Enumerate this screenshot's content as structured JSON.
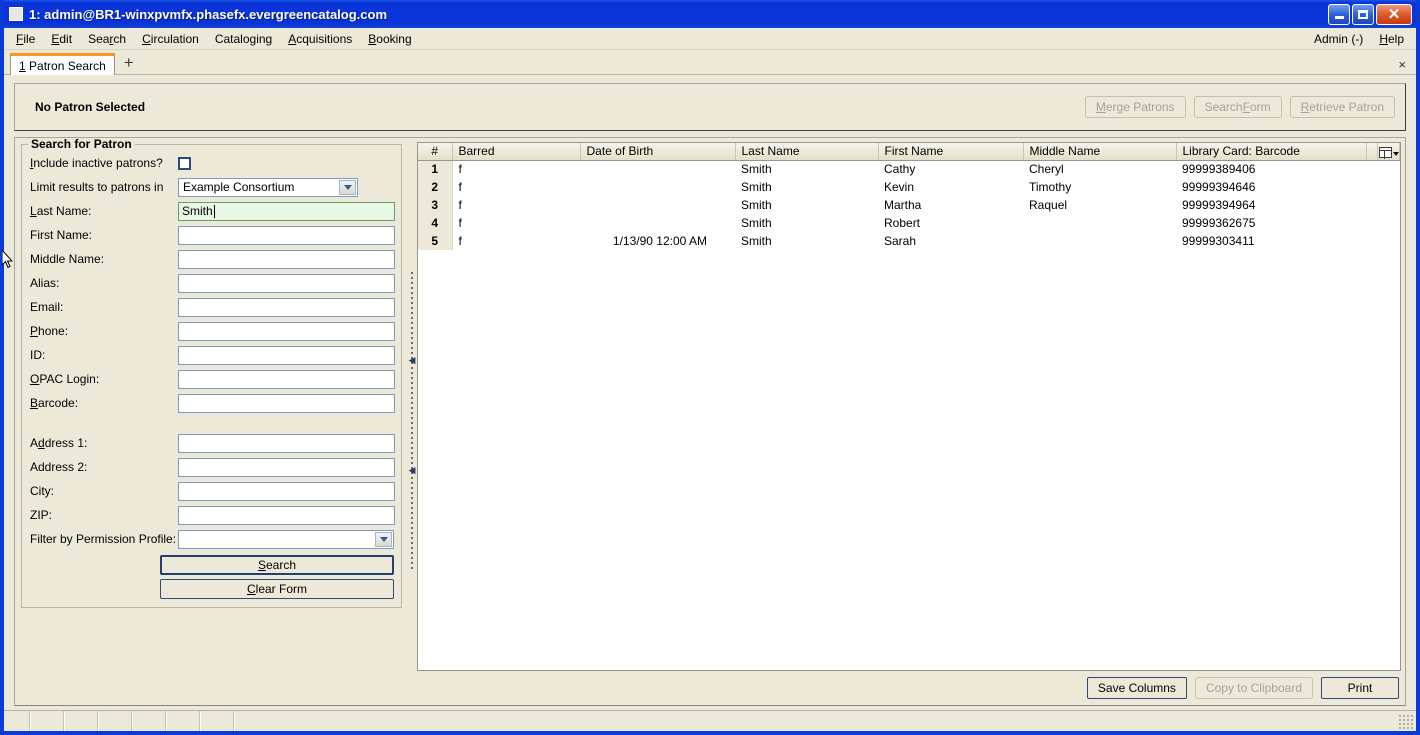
{
  "window": {
    "title": "1: admin@BR1-winxpvmfx.phasefx.evergreencatalog.com",
    "app_icon": "app-icon",
    "minimize_label": "Minimize",
    "maximize_label": "Maximize",
    "close_label": "Close"
  },
  "menubar": {
    "items": [
      {
        "label": "File",
        "accel": "F"
      },
      {
        "label": "Edit",
        "accel": "E"
      },
      {
        "label": "Search",
        "accel": "r"
      },
      {
        "label": "Circulation",
        "accel": "C"
      },
      {
        "label": "Cataloging",
        "accel": "g"
      },
      {
        "label": "Acquisitions",
        "accel": "A"
      },
      {
        "label": "Booking",
        "accel": "B"
      }
    ],
    "right_items": [
      {
        "label": "Admin (-)"
      },
      {
        "label": "Help"
      }
    ]
  },
  "tabs": {
    "items": [
      {
        "index": "1",
        "label": "Patron Search"
      }
    ],
    "add_label": "+",
    "close_label": "×"
  },
  "patron_header": {
    "status": "No Patron Selected",
    "buttons": [
      {
        "label": "Merge Patrons",
        "disabled": true
      },
      {
        "label": "Search Form",
        "disabled": true
      },
      {
        "label": "Retrieve Patron",
        "disabled": true
      }
    ]
  },
  "search_form": {
    "group_title": "Search for Patron",
    "include_inactive_label": "Include inactive patrons?",
    "include_inactive_checked": false,
    "limit_label": "Limit results to patrons in",
    "limit_value": "Example Consortium",
    "fields": [
      {
        "label": "Last Name:",
        "value": "Smith",
        "active": true
      },
      {
        "label": "First Name:",
        "value": "",
        "active": false
      },
      {
        "label": "Middle Name:",
        "value": "",
        "active": false
      },
      {
        "label": "Alias:",
        "value": "",
        "active": false
      },
      {
        "label": "Email:",
        "value": "",
        "active": false
      },
      {
        "label": "Phone:",
        "value": "",
        "active": false
      },
      {
        "label": "ID:",
        "value": "",
        "active": false
      },
      {
        "label": "OPAC Login:",
        "value": "",
        "active": false
      },
      {
        "label": "Barcode:",
        "value": "",
        "active": false
      }
    ],
    "address_fields": [
      {
        "label": "Address 1:",
        "value": ""
      },
      {
        "label": "Address 2:",
        "value": ""
      },
      {
        "label": "City:",
        "value": ""
      },
      {
        "label": "ZIP:",
        "value": ""
      }
    ],
    "permission_label": "Filter by Permission Profile:",
    "permission_value": "",
    "search_button": "Search",
    "clear_button": "Clear Form"
  },
  "results": {
    "columns": [
      {
        "key": "num",
        "label": "#"
      },
      {
        "key": "barred",
        "label": "Barred"
      },
      {
        "key": "dob",
        "label": "Date of Birth"
      },
      {
        "key": "last",
        "label": "Last Name"
      },
      {
        "key": "first",
        "label": "First Name"
      },
      {
        "key": "middle",
        "label": "Middle Name"
      },
      {
        "key": "barcode",
        "label": "Library Card: Barcode"
      }
    ],
    "rows": [
      {
        "num": "1",
        "barred": "f",
        "dob": "",
        "last": "Smith",
        "first": "Cathy",
        "middle": "Cheryl",
        "barcode": "99999389406"
      },
      {
        "num": "2",
        "barred": "f",
        "dob": "",
        "last": "Smith",
        "first": "Kevin",
        "middle": "Timothy",
        "barcode": "99999394646"
      },
      {
        "num": "3",
        "barred": "f",
        "dob": "",
        "last": "Smith",
        "first": "Martha",
        "middle": "Raquel",
        "barcode": "99999394964"
      },
      {
        "num": "4",
        "barred": "f",
        "dob": "",
        "last": "Smith",
        "first": "Robert",
        "middle": "",
        "barcode": "99999362675"
      },
      {
        "num": "5",
        "barred": "f",
        "dob": "1/13/90 12:00 AM",
        "last": "Smith",
        "first": "Sarah",
        "middle": "",
        "barcode": "99999303411"
      }
    ],
    "column_picker_icon": "column-picker-icon",
    "footer_buttons": [
      {
        "label": "Save Columns",
        "disabled": false
      },
      {
        "label": "Copy to Clipboard",
        "disabled": true
      },
      {
        "label": "Print",
        "disabled": false
      }
    ]
  },
  "colors": {
    "titlebar_blue": "#0a34d8",
    "chrome_beige": "#ece9d8",
    "active_field_green": "#e7f7e3",
    "tab_accent_orange": "#f59a23",
    "close_red": "#c53812"
  }
}
